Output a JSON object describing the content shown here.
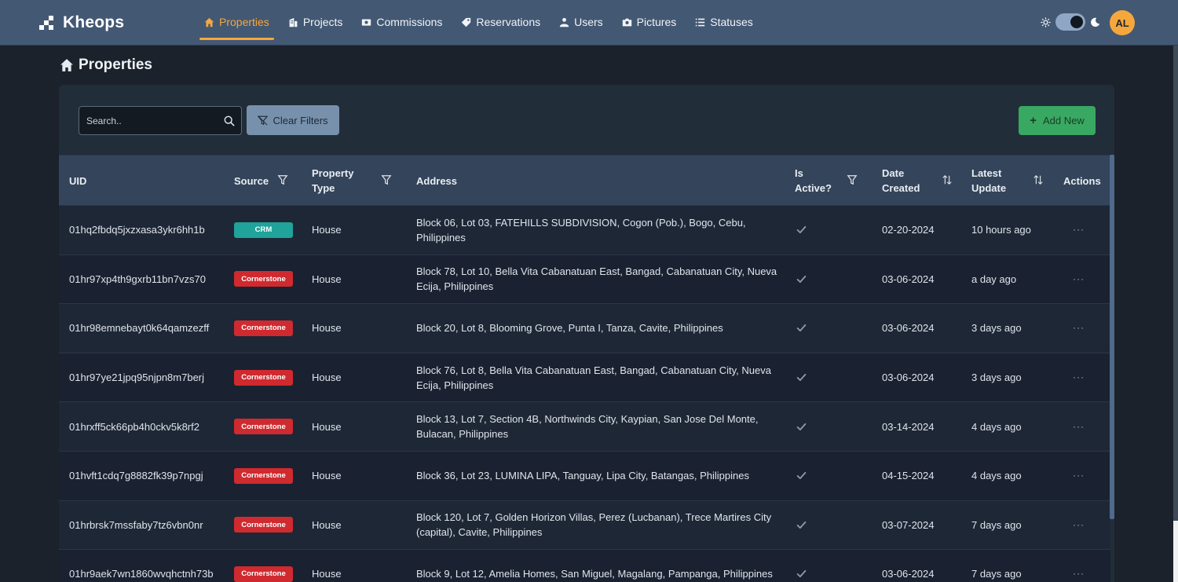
{
  "app": {
    "brand": "Kheops",
    "user_initials": "AL"
  },
  "nav": [
    {
      "label": "Properties",
      "icon": "home-icon",
      "active": true
    },
    {
      "label": "Projects",
      "icon": "building-icon",
      "active": false
    },
    {
      "label": "Commissions",
      "icon": "money-icon",
      "active": false
    },
    {
      "label": "Reservations",
      "icon": "tag-icon",
      "active": false
    },
    {
      "label": "Users",
      "icon": "users-icon",
      "active": false
    },
    {
      "label": "Pictures",
      "icon": "camera-icon",
      "active": false
    },
    {
      "label": "Statuses",
      "icon": "list-icon",
      "active": false
    }
  ],
  "page": {
    "title": "Properties"
  },
  "toolbar": {
    "search_placeholder": "Search..",
    "clear_filters": "Clear Filters",
    "add_new": "Add New"
  },
  "table": {
    "headers": {
      "uid": "UID",
      "source": "Source",
      "property_type": "Property Type",
      "address": "Address",
      "is_active": "Is Active?",
      "date_created": "Date Created",
      "latest_update": "Latest Update",
      "actions": "Actions"
    },
    "rows": [
      {
        "uid": "01hq2fbdq5jxzxasa3ykr6hh1b",
        "source": "CRM",
        "type": "House",
        "address": "Block 06, Lot 03, FATEHILLS SUBDIVISION, Cogon (Pob.), Bogo, Cebu, Philippines",
        "date_created": "02-20-2024",
        "latest_update": "10 hours ago"
      },
      {
        "uid": "01hr97xp4th9gxrb11bn7vzs70",
        "source": "Cornerstone",
        "type": "House",
        "address": "Block 78, Lot 10, Bella Vita Cabanatuan East, Bangad, Cabanatuan City, Nueva Ecija, Philippines",
        "date_created": "03-06-2024",
        "latest_update": "a day ago"
      },
      {
        "uid": "01hr98emnebayt0k64qamzezff",
        "source": "Cornerstone",
        "type": "House",
        "address": "Block 20, Lot 8, Blooming Grove, Punta I, Tanza, Cavite, Philippines",
        "date_created": "03-06-2024",
        "latest_update": "3 days ago"
      },
      {
        "uid": "01hr97ye21jpq95njpn8m7berj",
        "source": "Cornerstone",
        "type": "House",
        "address": "Block 76, Lot 8, Bella Vita Cabanatuan East, Bangad, Cabanatuan City, Nueva Ecija, Philippines",
        "date_created": "03-06-2024",
        "latest_update": "3 days ago"
      },
      {
        "uid": "01hrxff5ck66pb4h0ckv5k8rf2",
        "source": "Cornerstone",
        "type": "House",
        "address": "Block 13, Lot 7, Section 4B, Northwinds City, Kaypian, San Jose Del Monte, Bulacan, Philippines",
        "date_created": "03-14-2024",
        "latest_update": "4 days ago"
      },
      {
        "uid": "01hvft1cdq7g8882fk39p7npgj",
        "source": "Cornerstone",
        "type": "House",
        "address": "Block 36, Lot 23, LUMINA LIPA, Tanguay, Lipa City, Batangas, Philippines",
        "date_created": "04-15-2024",
        "latest_update": "4 days ago"
      },
      {
        "uid": "01hrbrsk7mssfaby7tz6vbn0nr",
        "source": "Cornerstone",
        "type": "House",
        "address": "Block 120, Lot 7, Golden Horizon Villas, Perez (Lucbanan), Trece Martires City (capital), Cavite, Philippines",
        "date_created": "03-07-2024",
        "latest_update": "7 days ago"
      },
      {
        "uid": "01hr9aek7wn1860wvqhctnh73b",
        "source": "Cornerstone",
        "type": "House",
        "address": "Block 9, Lot 12, Amelia Homes, San Miguel, Magalang, Pampanga, Philippines",
        "date_created": "03-06-2024",
        "latest_update": "7 days ago"
      }
    ]
  },
  "colors": {
    "accent": "#f6a73c",
    "crm_badge": "#1fa39a",
    "cornerstone_badge": "#cf2a2f",
    "add_button": "#39a862",
    "clear_button": "#7791ad"
  }
}
